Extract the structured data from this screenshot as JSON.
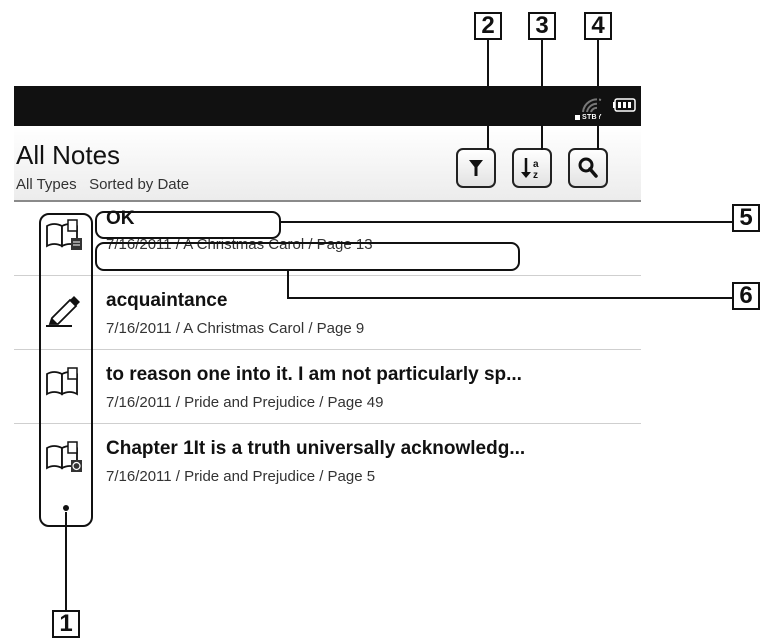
{
  "callouts": [
    "1",
    "2",
    "3",
    "4",
    "5",
    "6"
  ],
  "header": {
    "title": "All Notes",
    "subtitle": "All Types   Sorted by Date",
    "buttons": [
      {
        "name": "filter-button",
        "icon": "filter-icon"
      },
      {
        "name": "sort-button",
        "icon": "sort-az-icon"
      },
      {
        "name": "search-button",
        "icon": "search-icon"
      }
    ]
  },
  "status": {
    "standby": "STBY"
  },
  "notes": [
    {
      "icon": "bookmark-note-icon",
      "title": "OK",
      "meta": "7/16/2011 / A Christmas Carol / Page 13"
    },
    {
      "icon": "handwriting-icon",
      "title": "acquaintance",
      "meta": "7/16/2011 / A Christmas Carol / Page 9"
    },
    {
      "icon": "bookmark-icon",
      "title": "to reason one into it. I am not particularly sp...",
      "meta": "7/16/2011 / Pride and Prejudice / Page 49"
    },
    {
      "icon": "bookmark-highlight-icon",
      "title": "Chapter 1It is a truth universally acknowledg...",
      "meta": "7/16/2011 / Pride and Prejudice / Page 5"
    }
  ]
}
